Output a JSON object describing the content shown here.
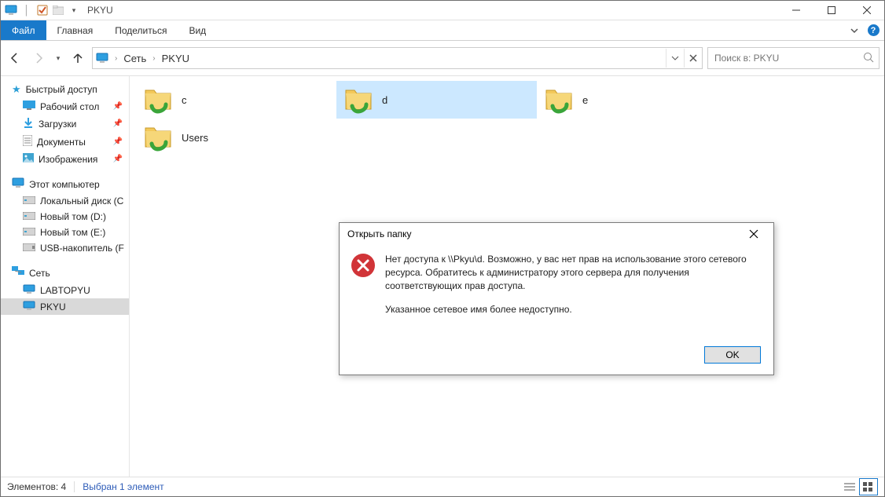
{
  "window": {
    "title": "PKYU"
  },
  "ribbon": {
    "tabs": {
      "file": "Файл",
      "home": "Главная",
      "share": "Поделиться",
      "view": "Вид"
    }
  },
  "address": {
    "root": "Сеть",
    "location": "PKYU"
  },
  "search": {
    "placeholder": "Поиск в: PKYU"
  },
  "sidebar": {
    "quick_access": "Быстрый доступ",
    "quick_items": [
      {
        "label": "Рабочий стол"
      },
      {
        "label": "Загрузки"
      },
      {
        "label": "Документы"
      },
      {
        "label": "Изображения"
      }
    ],
    "this_pc": "Этот компьютер",
    "drives": [
      {
        "label": "Локальный диск (C"
      },
      {
        "label": "Новый том (D:)"
      },
      {
        "label": "Новый том (E:)"
      },
      {
        "label": "USB-накопитель (F"
      }
    ],
    "network": "Сеть",
    "hosts": [
      {
        "label": "LABTOPYU"
      },
      {
        "label": "PKYU",
        "selected": true
      }
    ]
  },
  "folders": [
    {
      "name": "c"
    },
    {
      "name": "d",
      "selected": true
    },
    {
      "name": "e"
    },
    {
      "name": "Users"
    }
  ],
  "statusbar": {
    "count": "Элементов: 4",
    "selection": "Выбран 1 элемент"
  },
  "dialog": {
    "title": "Открыть папку",
    "message": "Нет доступа к \\\\Pkyu\\d. Возможно, у вас нет прав на использование этого сетевого ресурса. Обратитесь к администратору этого сервера для получения соответствующих прав доступа.",
    "detail": "Указанное сетевое имя более недоступно.",
    "ok": "OK"
  }
}
